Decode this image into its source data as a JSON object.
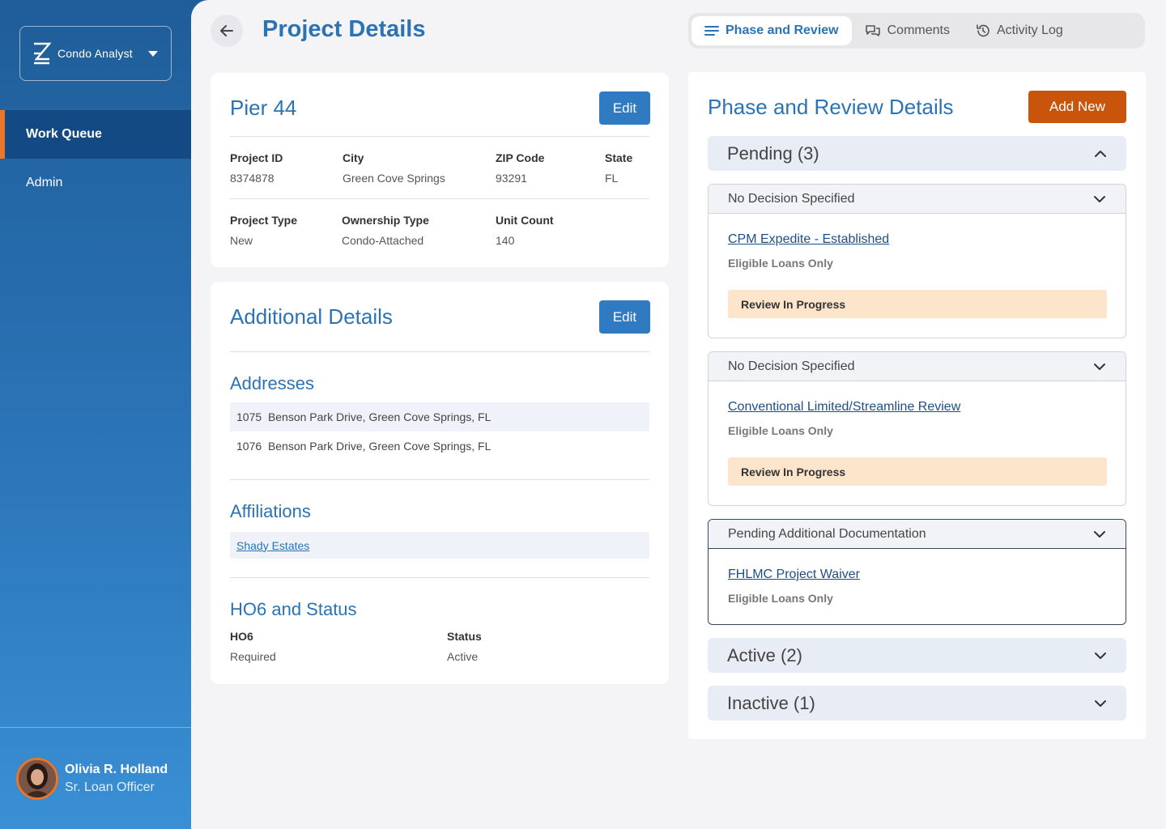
{
  "app": {
    "name": "Condo Analyst"
  },
  "sidebar": {
    "items": [
      {
        "label": "Work Queue",
        "active": true
      },
      {
        "label": "Admin",
        "active": false
      }
    ]
  },
  "user": {
    "name": "Olivia R. Holland",
    "role": "Sr. Loan Officer"
  },
  "header": {
    "title": "Project Details",
    "tabs": [
      {
        "label": "Phase and Review",
        "icon": "list-icon",
        "active": true
      },
      {
        "label": "Comments",
        "icon": "comments-icon",
        "active": false
      },
      {
        "label": "Activity Log",
        "icon": "history-icon",
        "active": false
      }
    ]
  },
  "project": {
    "name": "Pier 44",
    "edit_label": "Edit",
    "fields": {
      "project_id": {
        "label": "Project ID",
        "value": "8374878"
      },
      "city": {
        "label": "City",
        "value": "Green Cove Springs"
      },
      "zip": {
        "label": "ZIP Code",
        "value": "93291"
      },
      "state": {
        "label": "State",
        "value": "FL"
      },
      "project_type": {
        "label": "Project Type",
        "value": "New"
      },
      "ownership_type": {
        "label": "Ownership Type",
        "value": "Condo-Attached"
      },
      "unit_count": {
        "label": "Unit Count",
        "value": "140"
      }
    }
  },
  "additional": {
    "title": "Additional Details",
    "edit_label": "Edit",
    "addresses_title": "Addresses",
    "addresses": [
      {
        "number": "1075",
        "street": "Benson Park Drive, Green Cove Springs, FL"
      },
      {
        "number": "1076",
        "street": "Benson Park Drive, Green Cove Springs, FL"
      }
    ],
    "affiliations_title": "Affiliations",
    "affiliations": [
      "Shady Estates"
    ],
    "ho6_title": "HO6 and Status",
    "ho6": {
      "label": "HO6",
      "value": "Required"
    },
    "status": {
      "label": "Status",
      "value": "Active"
    }
  },
  "phase": {
    "title": "Phase and Review Details",
    "add_label": "Add New",
    "pending": {
      "label": "Pending (3)",
      "items": [
        {
          "decision": "No Decision Specified",
          "name": "CPM Expedite - Established",
          "eligibility": "Eligible Loans Only",
          "status": "Review In Progress"
        },
        {
          "decision": "No Decision Specified",
          "name": "Conventional Limited/Streamline Review",
          "eligibility": "Eligible Loans Only",
          "status": "Review In Progress"
        },
        {
          "decision": "Pending Additional Documentation",
          "name": "FHLMC Project Waiver",
          "eligibility": "Eligible Loans Only"
        }
      ]
    },
    "active": {
      "label": "Active (2)"
    },
    "inactive": {
      "label": "Inactive (1)"
    }
  },
  "colors": {
    "accent": "#2b73b3",
    "sidebar_active": "#134a84",
    "highlight": "#e8762b",
    "add_button": "#c9540b",
    "status_bg": "#fde5cc"
  }
}
